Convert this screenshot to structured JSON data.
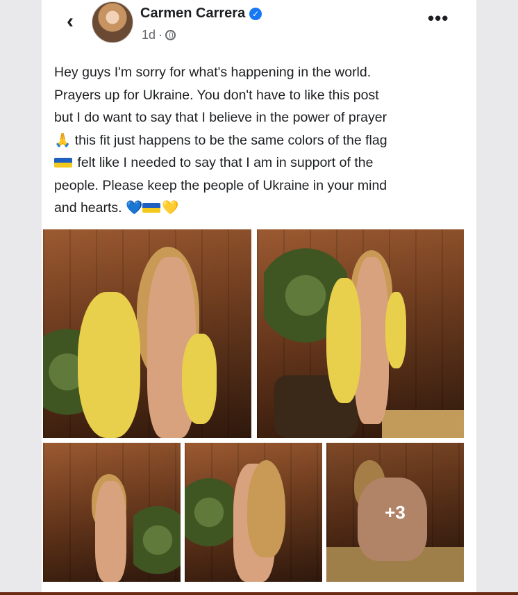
{
  "post": {
    "author_name": "Carmen Carrera",
    "time_label": "1d",
    "meta_separator": "·",
    "back_glyph": "‹",
    "more_glyph": "•••",
    "text_lines": [
      "Hey guys I'm sorry for what's happening in the world.",
      "Prayers up for Ukraine. You don't have to like this post",
      "but I do want to say that I believe in the power of prayer",
      "🙏 this fit just happens to be the same colors of the flag",
      "felt like I needed to say that I am in support of the",
      "people. Please keep the people of Ukraine in your mind",
      "and hearts. 💙",
      "💛"
    ],
    "extra_photos_label": "+3"
  },
  "colors": {
    "verified_blue": "#1877f2",
    "flag_blue": "#1f5fbf",
    "flag_yellow": "#f4c91d",
    "bottom_bar": "#6b2a14"
  },
  "icons": [
    "back-chevron-icon",
    "verified-badge-icon",
    "globe-icon",
    "more-options-icon",
    "praying-hands-emoji",
    "ukraine-flag-emoji",
    "blue-heart-emoji",
    "yellow-heart-emoji"
  ]
}
